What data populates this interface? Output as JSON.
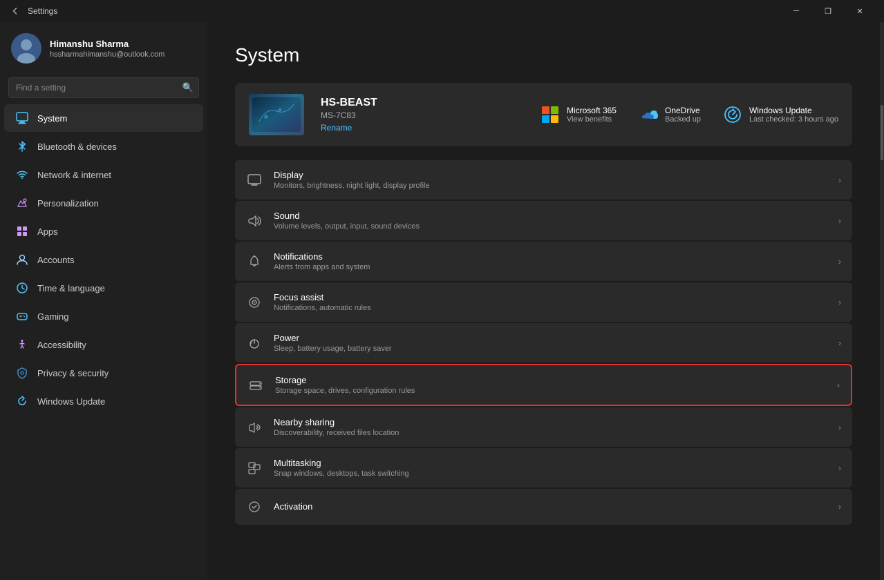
{
  "titlebar": {
    "back_label": "←",
    "title": "Settings",
    "minimize_label": "─",
    "restore_label": "❐",
    "close_label": "✕"
  },
  "sidebar": {
    "profile": {
      "name": "Himanshu Sharma",
      "email": "hssharmahimanshu@outlook.com"
    },
    "search": {
      "placeholder": "Find a setting"
    },
    "nav_items": [
      {
        "id": "system",
        "label": "System",
        "active": true
      },
      {
        "id": "bluetooth",
        "label": "Bluetooth & devices",
        "active": false
      },
      {
        "id": "network",
        "label": "Network & internet",
        "active": false
      },
      {
        "id": "personalization",
        "label": "Personalization",
        "active": false
      },
      {
        "id": "apps",
        "label": "Apps",
        "active": false
      },
      {
        "id": "accounts",
        "label": "Accounts",
        "active": false
      },
      {
        "id": "time",
        "label": "Time & language",
        "active": false
      },
      {
        "id": "gaming",
        "label": "Gaming",
        "active": false
      },
      {
        "id": "accessibility",
        "label": "Accessibility",
        "active": false
      },
      {
        "id": "privacy",
        "label": "Privacy & security",
        "active": false
      },
      {
        "id": "update",
        "label": "Windows Update",
        "active": false
      }
    ]
  },
  "content": {
    "title": "System",
    "system_card": {
      "device_name": "HS-BEAST",
      "device_model": "MS-7C83",
      "rename_label": "Rename",
      "links": [
        {
          "id": "ms365",
          "name": "Microsoft 365",
          "sub": "View benefits"
        },
        {
          "id": "onedrive",
          "name": "OneDrive",
          "sub": "Backed up"
        },
        {
          "id": "wupdate",
          "name": "Windows Update",
          "sub": "Last checked: 3 hours ago"
        }
      ]
    },
    "settings_rows": [
      {
        "id": "display",
        "title": "Display",
        "sub": "Monitors, brightness, night light, display profile",
        "highlighted": false
      },
      {
        "id": "sound",
        "title": "Sound",
        "sub": "Volume levels, output, input, sound devices",
        "highlighted": false
      },
      {
        "id": "notifications",
        "title": "Notifications",
        "sub": "Alerts from apps and system",
        "highlighted": false
      },
      {
        "id": "focus",
        "title": "Focus assist",
        "sub": "Notifications, automatic rules",
        "highlighted": false
      },
      {
        "id": "power",
        "title": "Power",
        "sub": "Sleep, battery usage, battery saver",
        "highlighted": false
      },
      {
        "id": "storage",
        "title": "Storage",
        "sub": "Storage space, drives, configuration rules",
        "highlighted": true
      },
      {
        "id": "nearby",
        "title": "Nearby sharing",
        "sub": "Discoverability, received files location",
        "highlighted": false
      },
      {
        "id": "multitasking",
        "title": "Multitasking",
        "sub": "Snap windows, desktops, task switching",
        "highlighted": false
      },
      {
        "id": "activation",
        "title": "Activation",
        "sub": "",
        "highlighted": false
      }
    ]
  }
}
